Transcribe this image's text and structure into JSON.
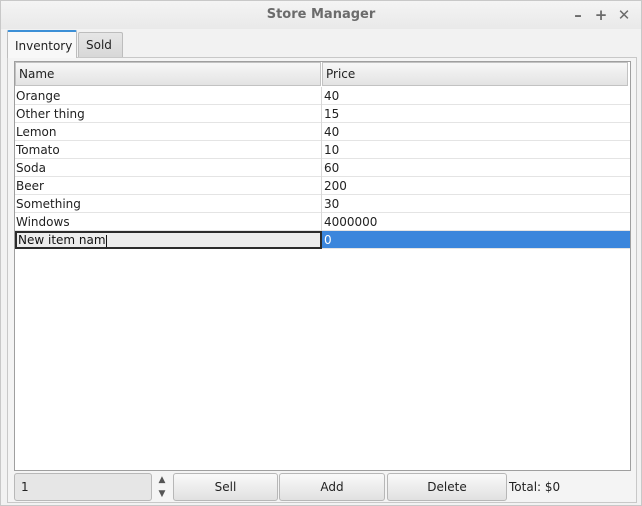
{
  "window": {
    "title": "Store Manager",
    "minimize_glyph": "–",
    "maximize_glyph": "+",
    "close_glyph": "✕"
  },
  "tabs": [
    {
      "label": "Inventory",
      "active": true
    },
    {
      "label": "Sold",
      "active": false
    }
  ],
  "table": {
    "columns": [
      "Name",
      "Price"
    ],
    "rows": [
      {
        "name": "Orange",
        "price": "40"
      },
      {
        "name": "Other thing",
        "price": "15"
      },
      {
        "name": "Lemon",
        "price": "40"
      },
      {
        "name": "Tomato",
        "price": "10"
      },
      {
        "name": "Soda",
        "price": "60"
      },
      {
        "name": "Beer",
        "price": "200"
      },
      {
        "name": "Something",
        "price": "30"
      },
      {
        "name": "Windows",
        "price": "4000000"
      }
    ],
    "editing_row": {
      "name": "New item nam",
      "price": "0"
    }
  },
  "controls": {
    "quantity_value": "1",
    "sell_label": "Sell",
    "add_label": "Add",
    "delete_label": "Delete",
    "total_label": "Total: $0"
  },
  "colors": {
    "selection": "#3b86dc",
    "active_tab_accent": "#3c8fd6"
  }
}
